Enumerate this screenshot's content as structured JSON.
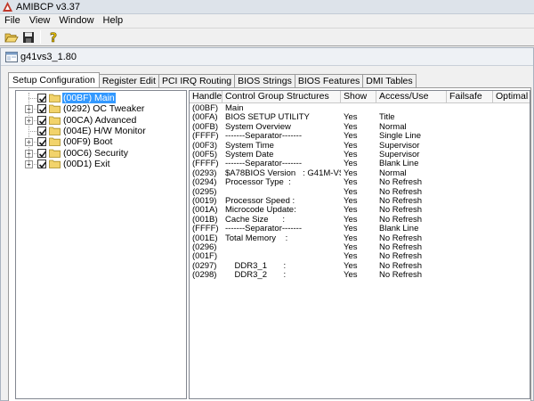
{
  "window": {
    "title": "AMIBCP v3.37"
  },
  "menu": [
    "File",
    "View",
    "Window",
    "Help"
  ],
  "toolbar": {
    "icons": [
      "open-folder-icon",
      "save-disk-icon",
      "help-icon"
    ]
  },
  "child": {
    "title": "g41vs3_1.80"
  },
  "tabs": [
    "Setup Configuration",
    "Register Edit",
    "PCI IRQ Routing",
    "BIOS Strings",
    "BIOS Features",
    "DMI Tables"
  ],
  "active_tab": "Setup Configuration",
  "tree": [
    {
      "label": "(00BF) Main",
      "selected": true,
      "has_children": false
    },
    {
      "label": "(0292) OC Tweaker",
      "selected": false,
      "has_children": true
    },
    {
      "label": "(00CA) Advanced",
      "selected": false,
      "has_children": true
    },
    {
      "label": "(004E) H/W Monitor",
      "selected": false,
      "has_children": false
    },
    {
      "label": "(00F9) Boot",
      "selected": false,
      "has_children": true
    },
    {
      "label": "(00C6) Security",
      "selected": false,
      "has_children": true
    },
    {
      "label": "(00D1) Exit",
      "selected": false,
      "has_children": true
    }
  ],
  "table": {
    "headers": [
      "Handle",
      "Control Group Structures",
      "Show",
      "Access/Use",
      "Failsafe",
      "Optimal"
    ],
    "rows": [
      [
        "(00BF)",
        "Main",
        "",
        "",
        "",
        ""
      ],
      [
        "(00FA)",
        "BIOS SETUP UTILITY",
        "Yes",
        "Title",
        "",
        ""
      ],
      [
        "(00FB)",
        "System Overview",
        "Yes",
        "Normal",
        "",
        ""
      ],
      [
        "(FFFF)",
        "-------Separator-------",
        "Yes",
        "Single Line",
        "",
        ""
      ],
      [
        "(00F3)",
        "System Time",
        "Yes",
        "Supervisor",
        "",
        ""
      ],
      [
        "(00F5)",
        "System Date",
        "Yes",
        "Supervisor",
        "",
        ""
      ],
      [
        "(FFFF)",
        "-------Separator-------",
        "Yes",
        "Blank Line",
        "",
        ""
      ],
      [
        "(0293)",
        "$A78BIOS Version   : G41M-VS3...",
        "Yes",
        "Normal",
        "",
        ""
      ],
      [
        "(0294)",
        "Processor Type  :",
        "Yes",
        "No Refresh",
        "",
        ""
      ],
      [
        "(0295)",
        "",
        "Yes",
        "No Refresh",
        "",
        ""
      ],
      [
        "(0019)",
        "Processor Speed :",
        "Yes",
        "No Refresh",
        "",
        ""
      ],
      [
        "(001A)",
        "Microcode Update:",
        "Yes",
        "No Refresh",
        "",
        ""
      ],
      [
        "(001B)",
        "Cache Size      :",
        "Yes",
        "No Refresh",
        "",
        ""
      ],
      [
        "(FFFF)",
        "-------Separator-------",
        "Yes",
        "Blank Line",
        "",
        ""
      ],
      [
        "(001E)",
        "Total Memory    :",
        "Yes",
        "No Refresh",
        "",
        ""
      ],
      [
        "(0296)",
        "",
        "Yes",
        "No Refresh",
        "",
        ""
      ],
      [
        "(001F)",
        "",
        "Yes",
        "No Refresh",
        "",
        ""
      ],
      [
        "(0297)",
        "    DDR3_1       :",
        "Yes",
        "No Refresh",
        "",
        ""
      ],
      [
        "(0298)",
        "    DDR3_2       :",
        "Yes",
        "No Refresh",
        "",
        ""
      ]
    ]
  },
  "colors": {
    "selection": "#3399ff",
    "folder": "#f2d36b"
  }
}
